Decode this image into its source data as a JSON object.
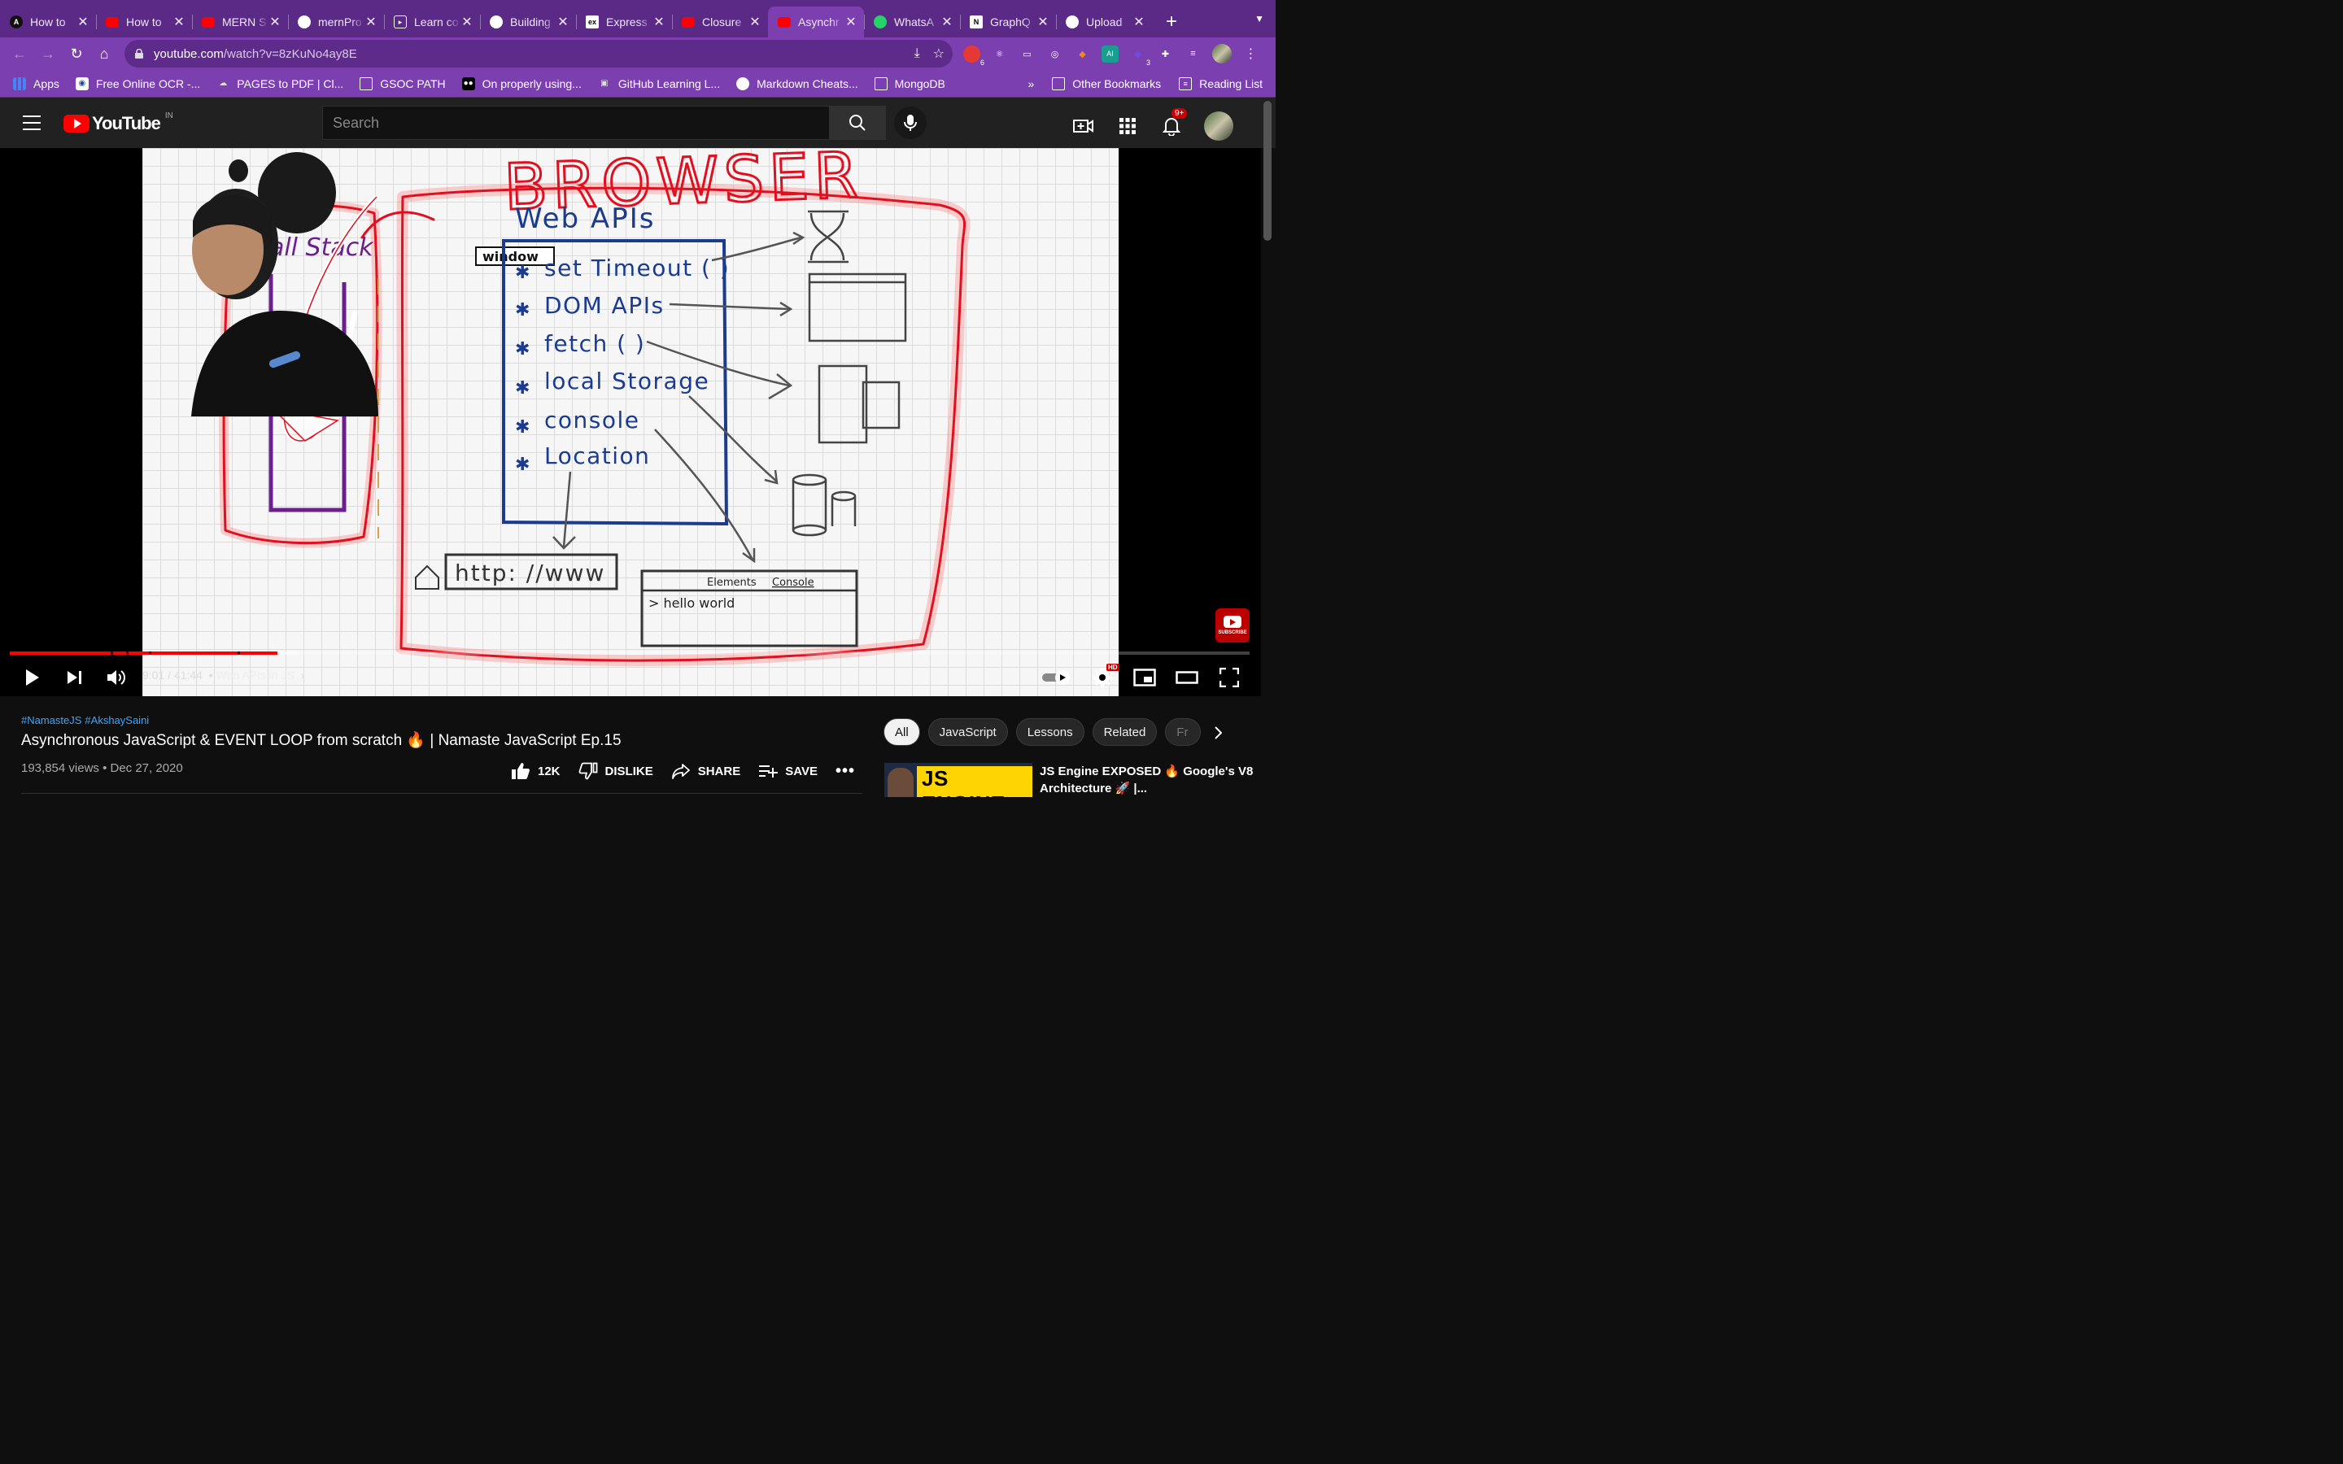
{
  "browser": {
    "tabs": [
      {
        "title": "How to",
        "icon": "a-logo-icon",
        "color": "#111111",
        "active": false
      },
      {
        "title": "How to",
        "icon": "youtube-icon",
        "color": "#ff0000",
        "active": false
      },
      {
        "title": "MERN S",
        "icon": "youtube-icon",
        "color": "#ff0000",
        "active": false
      },
      {
        "title": "mernPro",
        "icon": "github-icon",
        "color": "#ffffff",
        "active": false
      },
      {
        "title": "Learn co",
        "icon": "codecademy-icon",
        "color": "#ffffff",
        "active": false
      },
      {
        "title": "Building",
        "icon": "globe-icon",
        "color": "#ffffff",
        "active": false
      },
      {
        "title": "Express",
        "icon": "express-icon",
        "color": "#ffffff",
        "active": false
      },
      {
        "title": "Closure",
        "icon": "youtube-icon",
        "color": "#ff0000",
        "active": false
      },
      {
        "title": "Asynchr",
        "icon": "youtube-icon",
        "color": "#ff0000",
        "active": true
      },
      {
        "title": "WhatsA",
        "icon": "whatsapp-icon",
        "color": "#25d366",
        "active": false
      },
      {
        "title": "GraphQ",
        "icon": "notion-icon",
        "color": "#ffffff",
        "active": false
      },
      {
        "title": "Upload",
        "icon": "github-icon",
        "color": "#ffffff",
        "active": false
      }
    ],
    "url_host": "youtube.com",
    "url_path": "/watch?v=8zKuNo4ay8E",
    "extensions": [
      {
        "icon": "shield-ext-icon",
        "color": "#e53935",
        "count": "6"
      },
      {
        "icon": "react-devtools-icon",
        "color": "transparent",
        "count": ""
      },
      {
        "icon": "photo-ext-icon",
        "color": "transparent",
        "count": ""
      },
      {
        "icon": "target-ext-icon",
        "color": "transparent",
        "count": ""
      },
      {
        "icon": "metamask-fox-icon",
        "color": "transparent",
        "count": ""
      },
      {
        "icon": "ai-ext-icon",
        "color": "#1a9e8f",
        "count": ""
      },
      {
        "icon": "cube-ext-icon",
        "color": "transparent",
        "count": "3"
      },
      {
        "icon": "puzzle-icon",
        "color": "transparent",
        "count": ""
      },
      {
        "icon": "reading-queue-icon",
        "color": "transparent",
        "count": ""
      }
    ],
    "bookmarks": [
      {
        "label": "Apps",
        "icon": "apps-grid-icon"
      },
      {
        "label": "Free Online OCR -...",
        "icon": "ocr-icon"
      },
      {
        "label": "PAGES to PDF | Cl...",
        "icon": "cloud-convert-icon"
      },
      {
        "label": "GSOC PATH",
        "icon": "folder-icon"
      },
      {
        "label": "On properly using...",
        "icon": "medium-icon"
      },
      {
        "label": "GitHub Learning L...",
        "icon": "github-learning-icon"
      },
      {
        "label": "Markdown Cheats...",
        "icon": "github-icon"
      },
      {
        "label": "MongoDB",
        "icon": "folder-icon"
      }
    ],
    "more_bookmarks": "»",
    "other_bookmarks": "Other Bookmarks",
    "reading_list": "Reading List"
  },
  "youtube": {
    "logo_text": "YouTube",
    "country_code": "IN",
    "search_placeholder": "Search",
    "notification_count": "9+",
    "brand_red": "#ff0000"
  },
  "video": {
    "whiteboard": {
      "title": "BROWSER",
      "call_stack": "Call Stack",
      "web_apis": "Web APIs",
      "window": "window",
      "apis": [
        "set Timeout ( )",
        "DOM APIs",
        "fetch ( )",
        "local Storage",
        "console",
        "Location"
      ],
      "url_box": "http: //www",
      "devtools_tabs": [
        "Elements",
        "Console"
      ],
      "devtools_output": "> hello world"
    },
    "time_current": "9:01",
    "time_total": "41:44",
    "chapter": "Web APIs in JS",
    "progress": 0.216,
    "buffered": 0.233,
    "hd_badge": "HD",
    "subscribe_watermark": "SUBSCRIBE"
  },
  "meta": {
    "hashtags": [
      "#NamasteJS",
      "#AkshaySaini"
    ],
    "title": "Asynchronous JavaScript & EVENT LOOP from scratch 🔥  | Namaste JavaScript Ep.15",
    "views": "193,854 views",
    "date": "Dec 27, 2020",
    "likes": "12K",
    "dislike_label": "DISLIKE",
    "share_label": "SHARE",
    "save_label": "SAVE"
  },
  "sidebar": {
    "chips": [
      "All",
      "JavaScript",
      "Lessons",
      "Related",
      "Fr"
    ],
    "selected_chip": "All",
    "recommended": {
      "thumb_text": "JS ENGINE",
      "title": "JS Engine EXPOSED 🔥 Google's V8 Architecture 🚀 |..."
    }
  }
}
